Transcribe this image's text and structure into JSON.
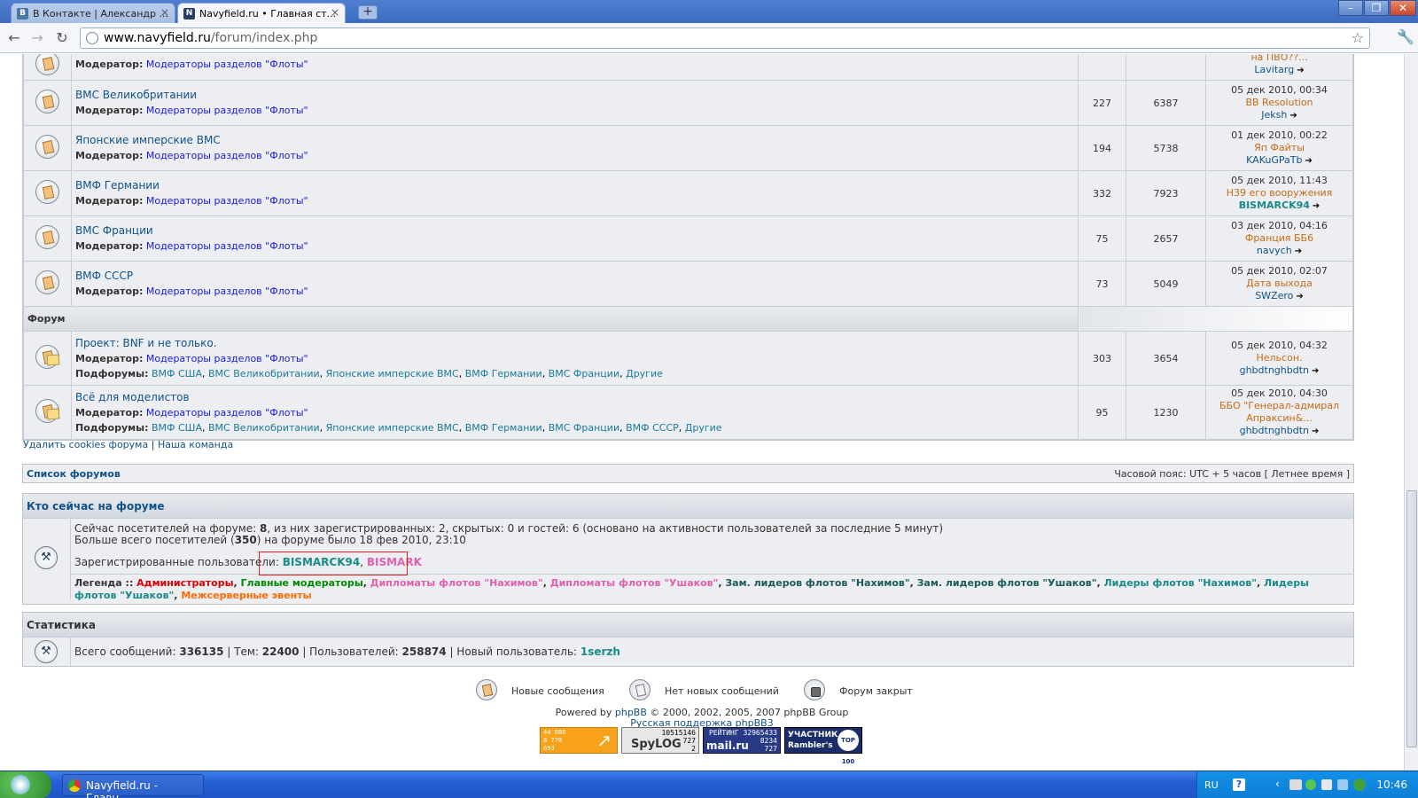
{
  "browser": {
    "tabs": [
      {
        "label": "В Контакте | Александр ...",
        "icon": "vk-icon",
        "active": false
      },
      {
        "label": "Navyfield.ru • Главная ст...",
        "icon": "navyfield-icon",
        "active": true
      }
    ],
    "url_host": "www.navyfield.ru",
    "url_path": "/forum/index.php"
  },
  "forums_top": [
    {
      "name": "",
      "mod_label": "Модератор:",
      "mod": "Модераторы разделов \"Флоты\"",
      "topics": "",
      "posts": "",
      "last_date": "",
      "last_title": "на ПВО??...",
      "last_user": "Lavitarg",
      "partial": true
    },
    {
      "name": "ВМС Великобритании",
      "mod_label": "Модератор:",
      "mod": "Модераторы разделов \"Флоты\"",
      "topics": "227",
      "posts": "6387",
      "last_date": "05 дек 2010, 00:34",
      "last_title": "BB Resolution",
      "last_user": "Jeksh"
    },
    {
      "name": "Японские имперские ВМС",
      "mod_label": "Модератор:",
      "mod": "Модераторы разделов \"Флоты\"",
      "topics": "194",
      "posts": "5738",
      "last_date": "01 дек 2010, 00:22",
      "last_title": "Яп Файты",
      "last_user": "KAKuGPaTb"
    },
    {
      "name": "ВМФ Германии",
      "mod_label": "Модератор:",
      "mod": "Модераторы разделов \"Флоты\"",
      "topics": "332",
      "posts": "7923",
      "last_date": "05 дек 2010, 11:43",
      "last_title": "H39 его вооружения",
      "last_user": "BISMARCK94",
      "user_teal": true
    },
    {
      "name": "ВМС Франции",
      "mod_label": "Модератор:",
      "mod": "Модераторы разделов \"Флоты\"",
      "topics": "75",
      "posts": "2657",
      "last_date": "03 дек 2010, 04:16",
      "last_title": "Франция ББ6",
      "last_user": "navych"
    },
    {
      "name": "ВМФ СССР",
      "mod_label": "Модератор:",
      "mod": "Модераторы разделов \"Флоты\"",
      "topics": "73",
      "posts": "5049",
      "last_date": "05 дек 2010, 02:07",
      "last_title": "Дата выхода",
      "last_user": "SWZero"
    }
  ],
  "section_title": "Форум",
  "forums_bottom": [
    {
      "name": "Проект: BNF и не только.",
      "mod_label": "Модератор:",
      "mod": "Модераторы разделов \"Флоты\"",
      "sub_label": "Подфорумы:",
      "subs": [
        "ВМФ США",
        "ВМС Великобритании",
        "Японские имперские ВМС",
        "ВМФ Германии",
        "ВМС Франции",
        "Другие"
      ],
      "topics": "303",
      "posts": "3654",
      "last_date": "05 дек 2010, 04:32",
      "last_title": "Нельсон.",
      "last_user": "ghbdtnghbdtn"
    },
    {
      "name": "Всё для моделистов",
      "mod_label": "Модератор:",
      "mod": "Модераторы разделов \"Флоты\"",
      "sub_label": "Подфорумы:",
      "subs": [
        "ВМФ США",
        "ВМС Великобритании",
        "Японские имперские ВМС",
        "ВМФ Германии",
        "ВМС Франции",
        "ВМФ СССР",
        "Другие"
      ],
      "topics": "95",
      "posts": "1230",
      "last_date": "05 дек 2010, 04:30",
      "last_title": "ББО \"Генерал-адмирал Апраксин&...",
      "last_user": "ghbdtnghbdtn"
    }
  ],
  "links": {
    "delete_cookies": "Удалить cookies форума",
    "sep": "|",
    "team": "Наша команда"
  },
  "navbar": {
    "left": "Список форумов",
    "right": "Часовой пояс: UTC + 5 часов [ Летнее время ]"
  },
  "online": {
    "title": "Кто сейчас на форуме",
    "line1_a": "Сейчас посетителей на форуме: ",
    "line1_b": "8",
    "line1_c": ", из них зарегистрированных: 2, скрытых: 0 и гостей: 6 (основано на активности пользователей за последние 5 минут)",
    "line2_a": "Больше всего посетителей (",
    "line2_b": "350",
    "line2_c": ") на форуме было 18 фев 2010, 23:10",
    "reg_label": "Зарегистрированные пользователи: ",
    "reg_user1": "BISMARCK94",
    "reg_sep": ", ",
    "reg_user2": "BISMARK",
    "legend_label": "Легенда :: ",
    "legend": [
      {
        "text": "Администраторы",
        "cls": "red"
      },
      {
        "text": "Главные модераторы",
        "cls": "green"
      },
      {
        "text": "Дипломаты флотов \"Нахимов\"",
        "cls": "pink"
      },
      {
        "text": "Дипломаты флотов \"Ушаков\"",
        "cls": "pink"
      },
      {
        "text": "Зам. лидеров флотов \"Нахимов\"",
        "cls": "dkteal"
      },
      {
        "text": "Зам. лидеров флотов \"Ушаков\"",
        "cls": "dkteal"
      },
      {
        "text": "Лидеры флотов \"Нахимов\"",
        "cls": "teal"
      },
      {
        "text": "Лидеры флотов \"Ушаков\"",
        "cls": "teal"
      },
      {
        "text": "Межсерверные эвенты",
        "cls": "orange"
      }
    ]
  },
  "stats": {
    "title": "Статистика",
    "total_posts_label": "Всего сообщений: ",
    "total_posts": "336135",
    "topics_label": " | Тем: ",
    "topics": "22400",
    "users_label": " | Пользователей: ",
    "users": "258874",
    "new_user_label": " | Новый пользователь: ",
    "new_user": "1serzh"
  },
  "footer_legend": [
    {
      "label": "Новые сообщения",
      "icon": "new-posts-icon"
    },
    {
      "label": "Нет новых сообщений",
      "icon": "no-new-posts-icon"
    },
    {
      "label": "Форум закрыт",
      "icon": "forum-locked-icon"
    }
  ],
  "powered": {
    "a": "Powered by ",
    "phpbb": "phpBB",
    "b": " © 2000, 2002, 2005, 2007 phpBB Group",
    "support": "Русская поддержка phpBB3"
  },
  "counters": [
    {
      "lines": [
        "44 888",
        "8 770",
        "693"
      ],
      "name": "liveinternet-counter"
    },
    {
      "lines": [
        "10515146",
        "727",
        "2"
      ],
      "name": "spylog-counter",
      "brand": "SpyLOG"
    },
    {
      "lines": [
        "РЕЙТИНГ 32965433",
        "8234",
        "727"
      ],
      "name": "mailru-counter",
      "brand": "mail.ru"
    },
    {
      "lines": [
        "УЧАСТНИК",
        "Rambler's",
        "TOP 100"
      ],
      "name": "rambler-counter"
    }
  ],
  "taskbar": {
    "app": "Navyfield.ru - Главн...",
    "lang": "RU",
    "clock": "10:46"
  }
}
